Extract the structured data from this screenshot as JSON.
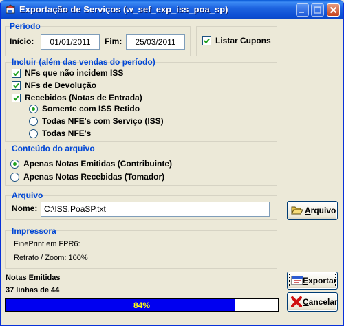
{
  "window": {
    "title": "Exportação de Serviços (w_sef_exp_iss_poa_sp)"
  },
  "periodo": {
    "legend": "Período",
    "inicio_label": "Início:",
    "inicio_value": "01/01/2011",
    "fim_label": "Fim:",
    "fim_value": "25/03/2011",
    "listar_cupons_label": "Listar Cupons",
    "listar_cupons_checked": true
  },
  "incluir": {
    "legend": "Incluir (além das vendas do período)",
    "items": [
      {
        "label": "NFs que não incidem ISS",
        "checked": true
      },
      {
        "label": "NFs de Devolução",
        "checked": true
      },
      {
        "label": "Recebidos (Notas de Entrada)",
        "checked": true
      }
    ],
    "recebidos_options": [
      {
        "label": "Somente com ISS Retido",
        "selected": true
      },
      {
        "label": "Todas NFE's com Serviço (ISS)",
        "selected": false
      },
      {
        "label": "Todas NFE's",
        "selected": false
      }
    ]
  },
  "conteudo": {
    "legend": "Conteúdo do arquivo",
    "options": [
      {
        "label": "Apenas Notas Emitidas (Contribuinte)",
        "selected": true
      },
      {
        "label": "Apenas Notas Recebidas (Tomador)",
        "selected": false
      }
    ]
  },
  "arquivo": {
    "legend": "Arquivo",
    "nome_label": "Nome:",
    "nome_value": "C:\\ISS.PoaSP.txt",
    "button_prefix": "",
    "button_accel": "A",
    "button_rest": "rquivo"
  },
  "impressora": {
    "legend": "Impressora",
    "line1": "FinePrint em FPR6:",
    "line2": "Retrato / Zoom: 100%"
  },
  "status": {
    "title": "Notas Emitidas",
    "lines": "37 linhas de 44",
    "progress_percent": 84,
    "progress_text": "84%"
  },
  "buttons": {
    "exportar_accel": "E",
    "exportar_rest": "xportar",
    "cancelar_accel": "C",
    "cancelar_rest": "ancelar"
  },
  "colors": {
    "accent": "#0046d5",
    "progress": "#0000f0",
    "titlebar": "#0a46c6"
  }
}
